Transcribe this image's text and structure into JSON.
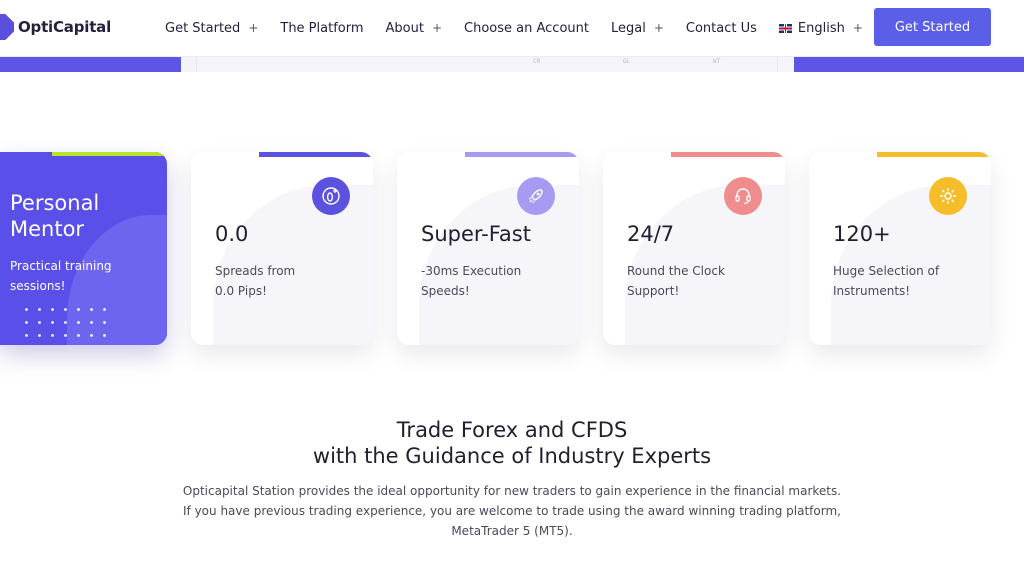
{
  "brand": {
    "name": "OptiCapital",
    "color": "#5b4fe0"
  },
  "nav": {
    "items": [
      {
        "label": "Get Started",
        "has_submenu": true
      },
      {
        "label": "The Platform",
        "has_submenu": false
      },
      {
        "label": "About",
        "has_submenu": true
      },
      {
        "label": "Choose an Account",
        "has_submenu": false
      },
      {
        "label": "Legal",
        "has_submenu": true
      },
      {
        "label": "Contact Us",
        "has_submenu": false
      }
    ],
    "language": {
      "label": "English",
      "flag": "uk-flag-icon"
    },
    "submenu_symbol": "+",
    "cta_label": "Get Started",
    "cta_color": "#5b5fe8"
  },
  "hero_strip": {
    "ghost_labels": [
      "CR",
      "GL",
      "WT"
    ]
  },
  "mentor_card": {
    "title_line1": "Personal",
    "title_line2": "Mentor",
    "subtitle": "Practical training sessions!",
    "background": "#5a4fe8"
  },
  "feature_cards": [
    {
      "value": "0.0",
      "desc_line1": "Spreads from",
      "desc_line2": "0.0 Pips!",
      "icon": "zero-plus-icon",
      "color": "#5b52e0",
      "bar_color": "#5b52e0"
    },
    {
      "value": "Super-Fast",
      "desc_line1": "-30ms Execution",
      "desc_line2": "Speeds!",
      "icon": "rocket-icon",
      "color": "#a69af2",
      "bar_color": "#a69af2"
    },
    {
      "value": "24/7",
      "desc_line1": "Round the Clock",
      "desc_line2": "Support!",
      "icon": "headset-icon",
      "color": "#ee8c8e",
      "bar_color": "#ee8c8e"
    },
    {
      "value": "120+",
      "desc_line1": "Huge Selection of",
      "desc_line2": "Instruments!",
      "icon": "gear-icon",
      "color": "#f6bd2b",
      "bar_color": "#f6bd2b"
    }
  ],
  "headline": {
    "line1": "Trade Forex and CFDS",
    "line2": "with the Guidance of Industry Experts"
  },
  "intro": {
    "line1": "Opticapital Station provides the ideal opportunity for new traders to gain experience in the financial markets.",
    "line2": "If you have previous trading experience, you are welcome to trade using the award winning trading platform,",
    "line3": "MetaTrader 5 (MT5)."
  }
}
